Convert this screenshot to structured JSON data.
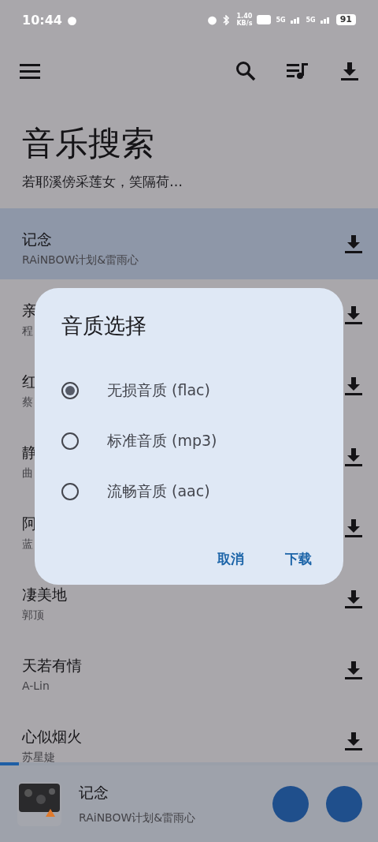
{
  "status_bar": {
    "time": "10:44",
    "speed": "1.40",
    "speed_unit": "KB/s",
    "network_1": "5G",
    "network_2": "5G",
    "battery": "91"
  },
  "title": "音乐搜索",
  "subtitle": "若耶溪傍采莲女，笑隔荷…",
  "songs": [
    {
      "title": "记念",
      "artist": "RAiNBOW计划&雷雨心",
      "selected": true
    },
    {
      "title": "亲",
      "artist": "程",
      "selected": false
    },
    {
      "title": "红",
      "artist": "蔡",
      "selected": false
    },
    {
      "title": "静",
      "artist": "曲",
      "selected": false
    },
    {
      "title": "阿",
      "artist": "蓝",
      "selected": false
    },
    {
      "title": "凄美地",
      "artist": "郭顶",
      "selected": false
    },
    {
      "title": "天若有情",
      "artist": "A-Lin",
      "selected": false
    },
    {
      "title": "心似烟火",
      "artist": "苏星婕",
      "selected": false
    }
  ],
  "player": {
    "title": "记念",
    "artist": "RAiNBOW计划&雷雨心",
    "level": 0.05
  },
  "dialog": {
    "title": "音质选择",
    "options": [
      {
        "label": "无损音质 (flac)",
        "selected": true
      },
      {
        "label": "标准音质 (mp3)",
        "selected": false
      },
      {
        "label": "流畅音质 (aac)",
        "selected": false
      }
    ],
    "buttons": [
      "取消",
      "下载"
    ]
  }
}
